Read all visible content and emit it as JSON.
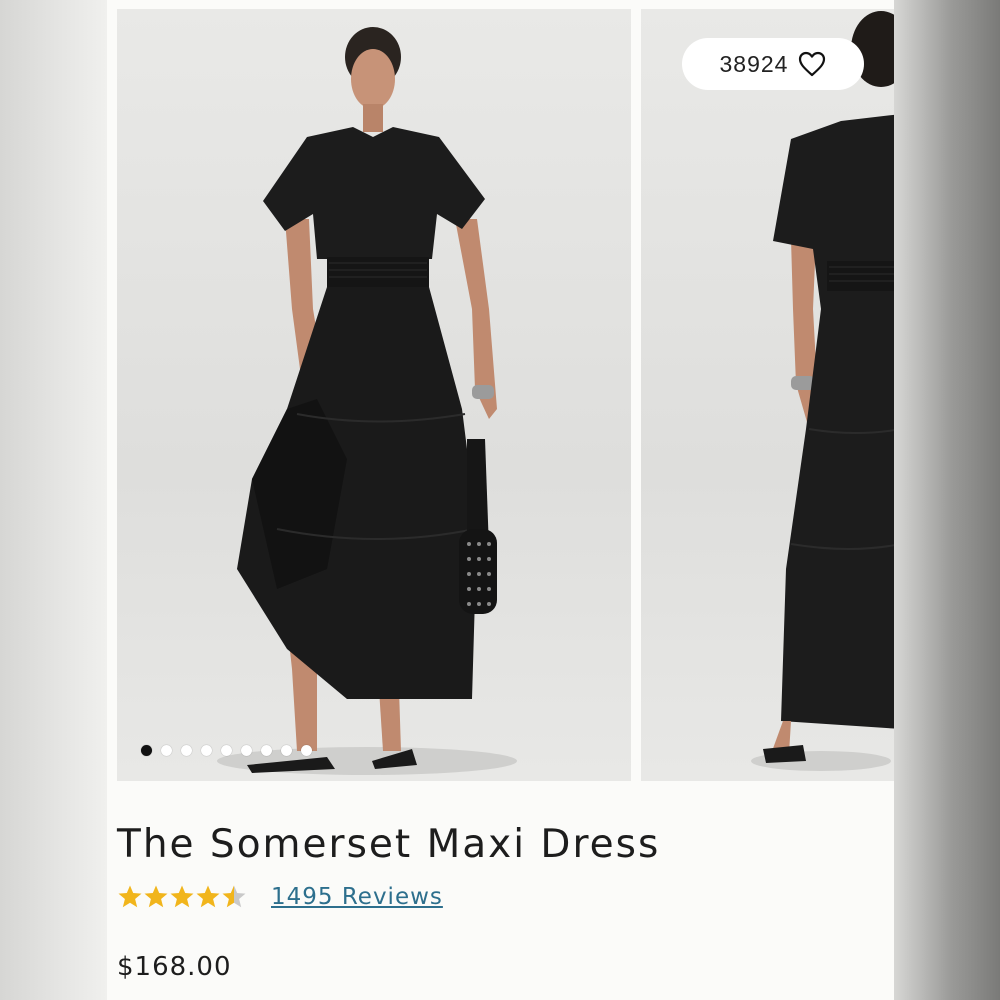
{
  "product": {
    "title": "The Somerset Maxi Dress",
    "rating": 4.5,
    "reviews_label": "1495 Reviews",
    "price": "$168.00"
  },
  "gallery": {
    "like_count": "38924",
    "heart_icon": "heart-outline-icon",
    "slide_count": 9,
    "active_slide": 1
  },
  "colors": {
    "star": "#f1b51c",
    "link": "#2d6f8d",
    "text": "#1d1d1d"
  }
}
